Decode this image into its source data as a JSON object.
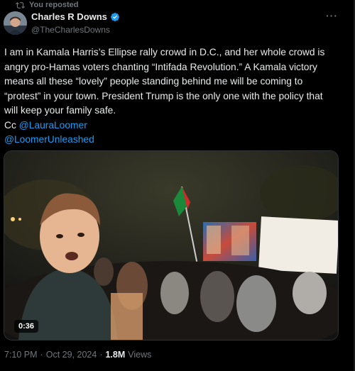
{
  "repost": {
    "label": "You reposted"
  },
  "author": {
    "name": "Charles R Downs",
    "handle": "@TheCharlesDowns"
  },
  "tweet": {
    "text_main": "I am in Kamala Harris’s Ellipse rally crowd in D.C., and her whole crowd is angry pro-Hamas voters chanting “Intifada Revolution.” A Kamala victory means all these “lovely” people standing behind me will be coming to “protest” in your town. President Trump is the only one with the policy that will keep your family safe.",
    "cc_prefix": "Cc",
    "mention_1": "@LauraLoomer",
    "mention_2": "@LoomerUnleashed"
  },
  "video": {
    "duration": "0:36"
  },
  "meta": {
    "time": "7:10 PM",
    "separator": "·",
    "date": "Oct 29, 2024",
    "views_count": "1.8M",
    "views_label": "Views"
  },
  "colors": {
    "accent": "#1d9bf0",
    "secondary_text": "#71767b",
    "background": "#000000"
  },
  "icons": {
    "repost": "repost-icon",
    "verified": "verified-badge-icon",
    "more": "more-options-icon"
  }
}
